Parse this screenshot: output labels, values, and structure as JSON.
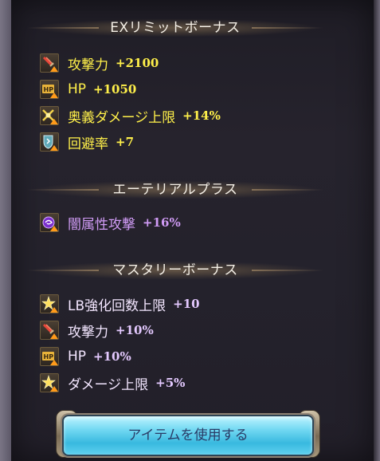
{
  "ex_limit": {
    "title": "EXリミットボーナス",
    "items": [
      {
        "label": "攻撃力",
        "value": "+2100",
        "icon": "attack-swords-icon"
      },
      {
        "label": "HP",
        "value": "+1050",
        "icon": "hp-icon"
      },
      {
        "label": "奥義ダメージ上限",
        "value": "+14%",
        "icon": "ougi-cap-icon"
      },
      {
        "label": "回避率",
        "value": "+7",
        "icon": "evasion-shield-icon"
      }
    ]
  },
  "aetherial": {
    "title": "エーテリアルプラス",
    "items": [
      {
        "label": "闇属性攻撃",
        "value": "+16%",
        "icon": "dark-element-icon"
      }
    ]
  },
  "mastery": {
    "title": "マスタリーボーナス",
    "items": [
      {
        "label": "LB強化回数上限",
        "value": "+10",
        "icon": "star-burst-icon"
      },
      {
        "label": "攻撃力",
        "value": "+10%",
        "icon": "attack-swords-icon"
      },
      {
        "label": "HP",
        "value": "+10%",
        "icon": "hp-icon"
      },
      {
        "label": "ダメージ上限",
        "value": "+5%",
        "icon": "star-burst-icon"
      }
    ]
  },
  "action_button": {
    "label": "アイテムを使用する"
  },
  "colors": {
    "bonus_text": "#fff04a",
    "dark_text": "#d09bf5",
    "mastery_label": "#f3e6ff",
    "button_fill": "#5ccbee",
    "button_text": "#2a3b66"
  }
}
